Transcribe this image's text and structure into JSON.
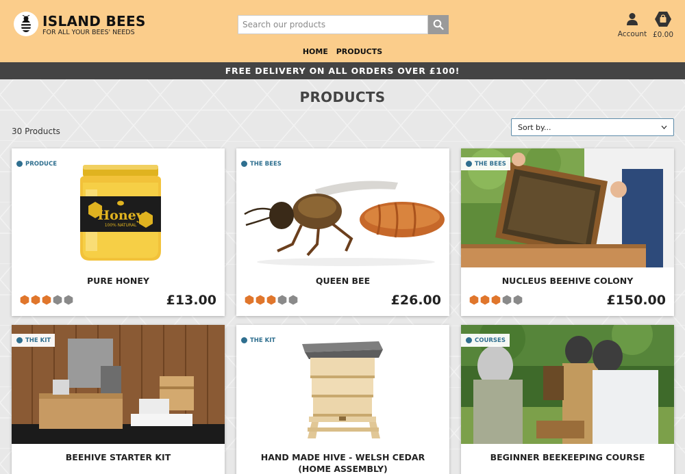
{
  "brand": {
    "name": "ISLAND BEES",
    "tagline": "FOR ALL YOUR BEES' NEEDS"
  },
  "search": {
    "placeholder": "Search our products"
  },
  "account": {
    "label": "Account",
    "icon": "user-icon"
  },
  "bag": {
    "total": "£0.00",
    "icon": "bag-icon"
  },
  "nav": {
    "home": "HOME",
    "products": "PRODUCTS"
  },
  "banner": "FREE DELIVERY ON ALL ORDERS OVER £100!",
  "page": {
    "title": "PRODUCTS",
    "count": "30 Products",
    "sort_label": "Sort by..."
  },
  "colors": {
    "header": "#fbcd8b",
    "banner": "#444444",
    "accent": "#2f6f8f",
    "rating_on": "#e0762c",
    "rating_off": "#8a8a8a"
  },
  "products": [
    {
      "category": "PRODUCE",
      "name": "PURE HONEY",
      "price": "£13.00",
      "rating": 3,
      "rating_max": 5
    },
    {
      "category": "THE BEES",
      "name": "QUEEN BEE",
      "price": "£26.00",
      "rating": 3,
      "rating_max": 5
    },
    {
      "category": "THE BEES",
      "name": "NUCLEUS BEEHIVE COLONY",
      "price": "£150.00",
      "rating": 3,
      "rating_max": 5
    },
    {
      "category": "THE KIT",
      "name": "BEEHIVE STARTER KIT"
    },
    {
      "category": "THE KIT",
      "name": "HAND MADE HIVE - WELSH CEDAR (HOME ASSEMBLY)"
    },
    {
      "category": "COURSES",
      "name": "BEGINNER BEEKEEPING COURSE"
    }
  ]
}
